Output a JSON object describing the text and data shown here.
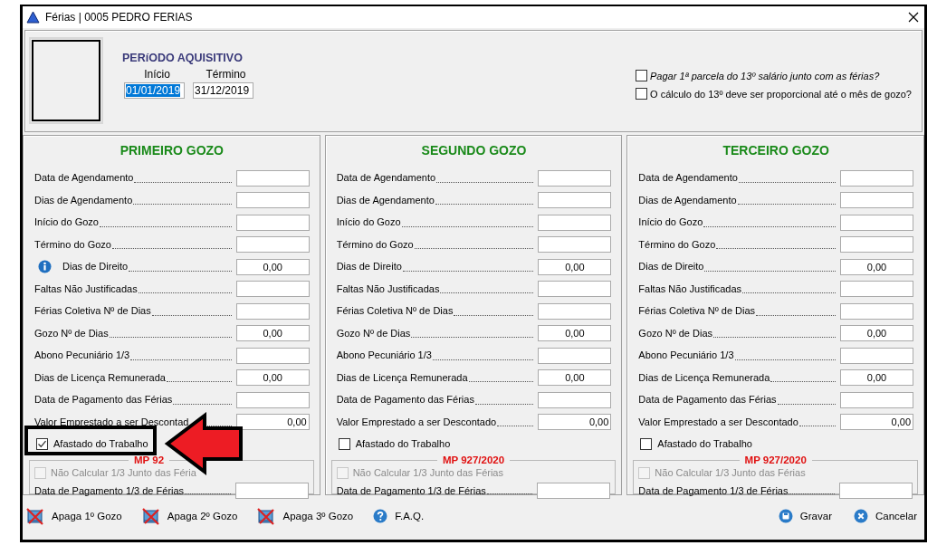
{
  "window": {
    "title": "Férias | 0005 PEDRO FERIAS"
  },
  "header": {
    "section_title": "PERíODO AQUISITIVO",
    "start": {
      "label": "Início",
      "value": "01/01/2019",
      "selected": true
    },
    "end": {
      "label": "Término",
      "value": "31/12/2019",
      "selected": false
    },
    "options": [
      {
        "label": "Pagar 1ª parcela do 13º salário junto com as férias?",
        "checked": false,
        "italic": true
      },
      {
        "label": "O cálculo do 13º deve ser proporcional até o mês de gozo?",
        "checked": false,
        "italic": false
      }
    ]
  },
  "panels": [
    {
      "title": "PRIMEIRO GOZO",
      "rows": [
        {
          "kind": "field",
          "label": "Data de Agendamento"
        },
        {
          "kind": "field",
          "label": "Dias de Agendamento"
        },
        {
          "kind": "field",
          "label": "Início do Gozo"
        },
        {
          "kind": "field",
          "label": "Término do Gozo"
        },
        {
          "kind": "info-field",
          "label": "Dias de Direito",
          "value": "0,00"
        },
        {
          "kind": "field",
          "label": "Faltas Não Justificadas"
        },
        {
          "kind": "field",
          "label": "Férias Coletiva Nº de Dias"
        },
        {
          "kind": "field",
          "label": "Gozo Nº de Dias",
          "value": "0,00"
        },
        {
          "kind": "field",
          "label": "Abono Pecuniário 1/3"
        },
        {
          "kind": "field",
          "label": "Dias de Licença Remunerada",
          "value": "0,00"
        },
        {
          "kind": "field",
          "label": "Data de Pagamento das Férias"
        },
        {
          "kind": "amount-field",
          "label": "Valor Emprestado a ser Descontad",
          "value": "0,00"
        }
      ],
      "away": {
        "label": "Afastado do Trabalho",
        "checked": true
      },
      "highlighted": true,
      "mp": {
        "title": "MP 92",
        "not_calc": {
          "label": "Não Calcular 1/3 Junto das Féria",
          "checked": false,
          "disabled": true
        },
        "pay_label": "Data de Pagamento 1/3 de Férias"
      }
    },
    {
      "title": "SEGUNDO GOZO",
      "rows": [
        {
          "kind": "field",
          "label": "Data de Agendamento"
        },
        {
          "kind": "field",
          "label": "Dias de Agendamento"
        },
        {
          "kind": "field",
          "label": "Início do Gozo"
        },
        {
          "kind": "field",
          "label": "Término do Gozo"
        },
        {
          "kind": "field",
          "label": "Dias de Direito",
          "value": "0,00"
        },
        {
          "kind": "field",
          "label": "Faltas Não Justificadas"
        },
        {
          "kind": "field",
          "label": "Férias Coletiva Nº de Dias"
        },
        {
          "kind": "field",
          "label": "Gozo Nº de Dias",
          "value": "0,00"
        },
        {
          "kind": "field",
          "label": "Abono Pecuniário 1/3"
        },
        {
          "kind": "field",
          "label": "Dias de Licença Remunerada",
          "value": "0,00"
        },
        {
          "kind": "field",
          "label": "Data de Pagamento das Férias"
        },
        {
          "kind": "amount-field",
          "label": "Valor Emprestado a ser Descontado",
          "value": "0,00"
        }
      ],
      "away": {
        "label": "Afastado do Trabalho",
        "checked": false
      },
      "highlighted": false,
      "mp": {
        "title": "MP 927/2020",
        "not_calc": {
          "label": "Não Calcular 1/3 Junto das Férias",
          "checked": false,
          "disabled": true
        },
        "pay_label": "Data de Pagamento 1/3 de Férias"
      }
    },
    {
      "title": "TERCEIRO GOZO",
      "rows": [
        {
          "kind": "field",
          "label": "Data de Agendamento"
        },
        {
          "kind": "field",
          "label": "Dias de Agendamento"
        },
        {
          "kind": "field",
          "label": "Início do Gozo"
        },
        {
          "kind": "field",
          "label": "Término do Gozo"
        },
        {
          "kind": "field",
          "label": "Dias de Direito",
          "value": "0,00"
        },
        {
          "kind": "field",
          "label": "Faltas Não Justificadas"
        },
        {
          "kind": "field",
          "label": "Férias Coletiva Nº de Dias"
        },
        {
          "kind": "field",
          "label": "Gozo Nº de Dias",
          "value": "0,00"
        },
        {
          "kind": "field",
          "label": "Abono Pecuniário 1/3"
        },
        {
          "kind": "field",
          "label": "Dias de Licença Remunerada",
          "value": "0,00"
        },
        {
          "kind": "field",
          "label": "Data de Pagamento das Férias"
        },
        {
          "kind": "amount-field",
          "label": "Valor Emprestado a ser Descontado",
          "value": "0,00"
        }
      ],
      "away": {
        "label": "Afastado do Trabalho",
        "checked": false
      },
      "highlighted": false,
      "mp": {
        "title": "MP 927/2020",
        "not_calc": {
          "label": "Não Calcular 1/3 Junto das Férias",
          "checked": false,
          "disabled": true
        },
        "pay_label": "Data de Pagamento 1/3 de Férias"
      }
    }
  ],
  "footer": {
    "left": [
      {
        "label": "Apaga 1º Gozo"
      },
      {
        "label": "Apaga 2º Gozo"
      },
      {
        "label": "Apaga 3º Gozo"
      },
      {
        "label": "F.A.Q."
      }
    ],
    "right": [
      {
        "label": "Gravar"
      },
      {
        "label": "Cancelar"
      }
    ]
  }
}
